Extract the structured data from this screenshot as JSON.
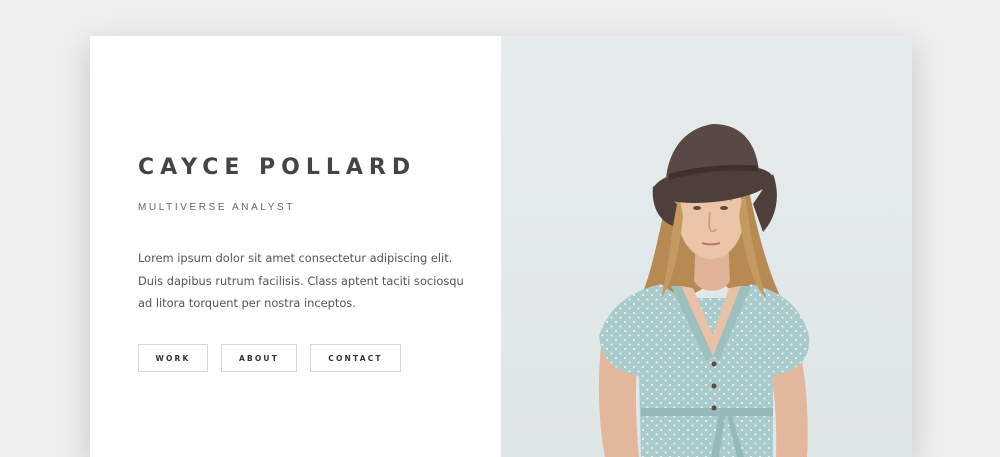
{
  "profile": {
    "name": "CAYCE POLLARD",
    "title": "MULTIVERSE ANALYST",
    "bio": "Lorem ipsum dolor sit amet consectetur adipiscing elit. Duis dapibus rutrum facilisis. Class aptent taciti sociosqu ad litora torquent per nostra inceptos."
  },
  "nav": {
    "buttons": [
      {
        "label": "WORK"
      },
      {
        "label": "ABOUT"
      },
      {
        "label": "CONTACT"
      }
    ]
  },
  "colors": {
    "page_background": "#efefef",
    "card_background": "#ffffff",
    "photo_background": "#e3eaec",
    "text_dark": "#444444",
    "text_muted": "#666666",
    "button_border": "#d6d6d6"
  },
  "photo": {
    "subject": "portrait-photo"
  }
}
